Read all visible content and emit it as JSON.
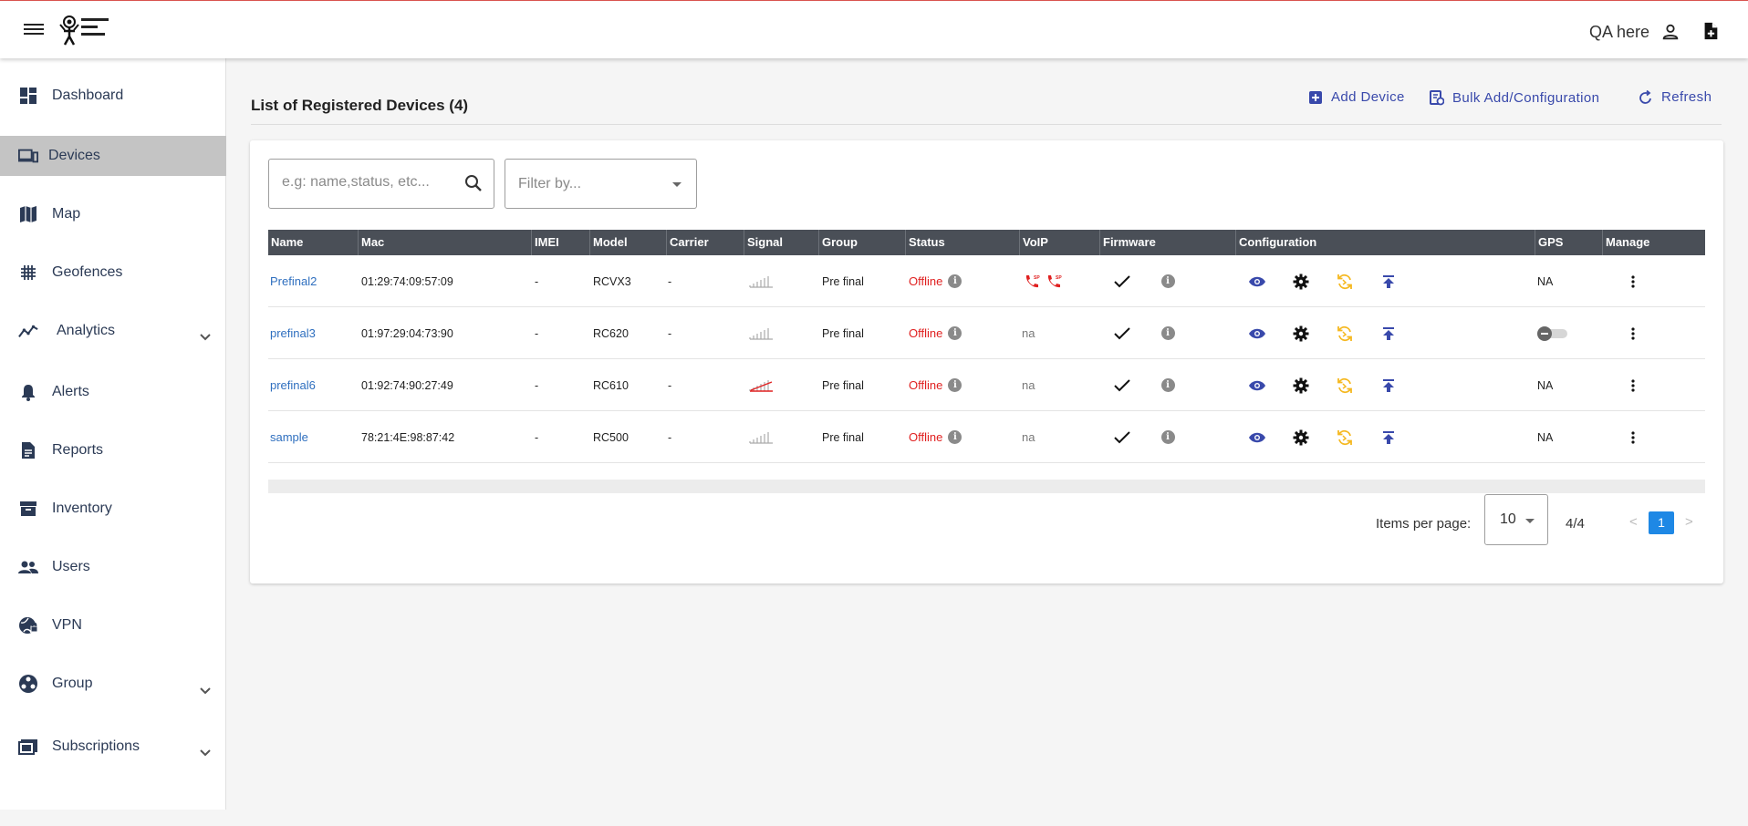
{
  "header": {
    "user_name": "QA here",
    "logo_alt": "Software Test Engineer"
  },
  "sidebar": {
    "items": [
      {
        "label": "Dashboard",
        "icon": "dashboard-icon"
      },
      {
        "label": "Devices",
        "icon": "devices-icon",
        "active": true
      },
      {
        "label": "Map",
        "icon": "map-icon"
      },
      {
        "label": "Geofences",
        "icon": "geofence-icon"
      },
      {
        "label": "Analytics",
        "icon": "analytics-icon",
        "expandable": true
      },
      {
        "label": "Alerts",
        "icon": "bell-icon"
      },
      {
        "label": "Reports",
        "icon": "reports-icon"
      },
      {
        "label": "Inventory",
        "icon": "inventory-icon"
      },
      {
        "label": "Users",
        "icon": "users-icon"
      },
      {
        "label": "VPN",
        "icon": "vpn-icon"
      },
      {
        "label": "Group",
        "icon": "group-icon",
        "expandable": true
      },
      {
        "label": "Subscriptions",
        "icon": "subscriptions-icon",
        "expandable": true
      }
    ]
  },
  "main": {
    "title": "List of Registered Devices (4)",
    "actions": {
      "add": "Add Device",
      "bulk": "Bulk Add/Configuration",
      "refresh": "Refresh"
    },
    "search": {
      "placeholder": "e.g: name,status, etc..."
    },
    "filter": {
      "placeholder": "Filter by..."
    }
  },
  "table": {
    "columns": [
      "Name",
      "Mac",
      "IMEI",
      "Model",
      "Carrier",
      "Signal",
      "Group",
      "Status",
      "VoIP",
      "Firmware",
      "Configuration",
      "GPS",
      "Manage"
    ],
    "rows": [
      {
        "name": "Prefinal2",
        "mac": "01:29:74:09:57:09",
        "imei": "-",
        "model": "RCVX3",
        "carrier": "-",
        "group": "Pre final",
        "status": "Offline",
        "voip": "",
        "gps": "NA"
      },
      {
        "name": "prefinal3",
        "mac": "01:97:29:04:73:90",
        "imei": "-",
        "model": "RC620",
        "carrier": "-",
        "group": "Pre final",
        "status": "Offline",
        "voip": "na",
        "gps": ""
      },
      {
        "name": "prefinal6",
        "mac": "01:92:74:90:27:49",
        "imei": "-",
        "model": "RC610",
        "carrier": "-",
        "group": "Pre final",
        "status": "Offline",
        "voip": "na",
        "gps": "NA"
      },
      {
        "name": "sample",
        "mac": "78:21:4E:98:87:42",
        "imei": "-",
        "model": "RC500",
        "carrier": "-",
        "group": "Pre final",
        "status": "Offline",
        "voip": "na",
        "gps": "NA"
      }
    ]
  },
  "pagination": {
    "items_per_page_label": "Items per page:",
    "items_per_page": "10",
    "count": "4/4",
    "current_page": "1",
    "prev": "<",
    "next": ">"
  },
  "colors": {
    "accent": "#3949ab",
    "status_offline": "#e02020",
    "link": "#2f6fbf",
    "header_bg": "#4a4f57",
    "active_nav": "#c4c4c4",
    "sync_icon": "#f5b820"
  }
}
